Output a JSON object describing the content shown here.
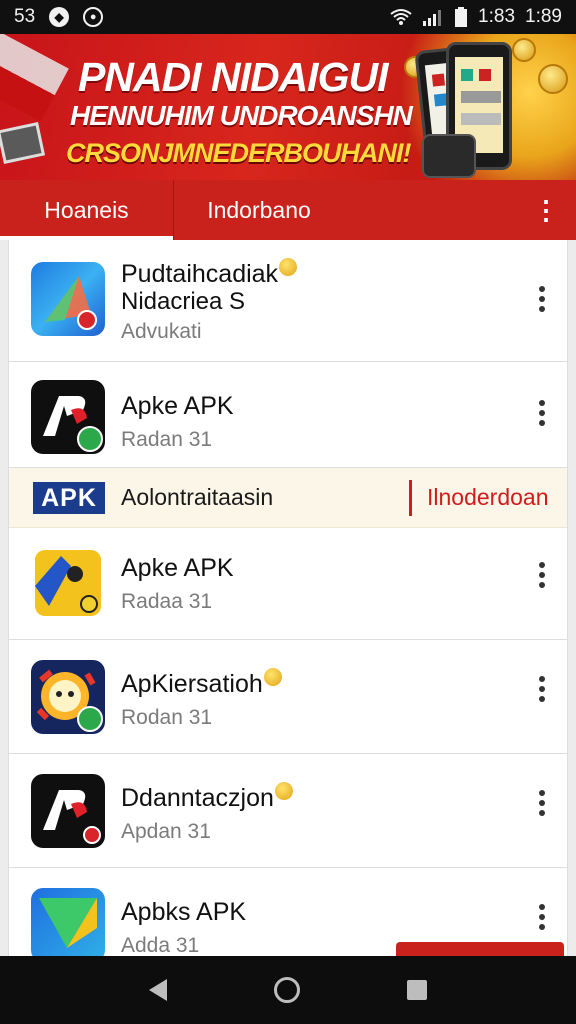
{
  "status_bar": {
    "left_text": "53",
    "right_date": "1:83",
    "time": "1:89"
  },
  "banner": {
    "line1": "PNADI NIDAIGUI",
    "line2": "HENNUHIM UNDROANSHN",
    "line3": "CRSONJMNEDERBOUHANI!"
  },
  "tabs": [
    {
      "label": "Hoaneis"
    },
    {
      "label": "Indorbano"
    }
  ],
  "apps": [
    {
      "title_line1": "Pudtaihcadiak",
      "title_line2": "Nidacriea S",
      "subtitle": "Advukati"
    },
    {
      "title": "Apke APK",
      "subtitle": "Radan 31"
    },
    {
      "title": "Apke APK",
      "subtitle": "Radaa 31"
    },
    {
      "title": "ApKiersatioh",
      "subtitle": "Rodan 31"
    },
    {
      "title": "Ddanntaczjon",
      "subtitle": "Apdan 31"
    },
    {
      "title": "Apbks APK",
      "subtitle": "Adda 31"
    }
  ],
  "promo": {
    "badge": "APK",
    "text": "Aolontraitaasin",
    "cta": "Ilnoderdoan"
  },
  "colors": {
    "accent": "#c9211c",
    "promo_badge": "#1b3b8c"
  }
}
